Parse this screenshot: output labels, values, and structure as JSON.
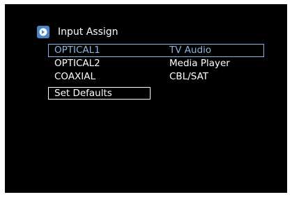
{
  "header": {
    "title": "Input Assign",
    "icon": "arrow-right-icon",
    "icon_color": "#4a86c5"
  },
  "rows": [
    {
      "source": "OPTICAL1",
      "assignment": "TV Audio",
      "selected": true
    },
    {
      "source": "OPTICAL2",
      "assignment": "Media Player",
      "selected": false
    },
    {
      "source": "COAXIAL",
      "assignment": "CBL/SAT",
      "selected": false
    }
  ],
  "actions": {
    "set_defaults": "Set Defaults"
  },
  "colors": {
    "background": "#000000",
    "text": "#ffffff",
    "highlight": "#8fb3de"
  }
}
